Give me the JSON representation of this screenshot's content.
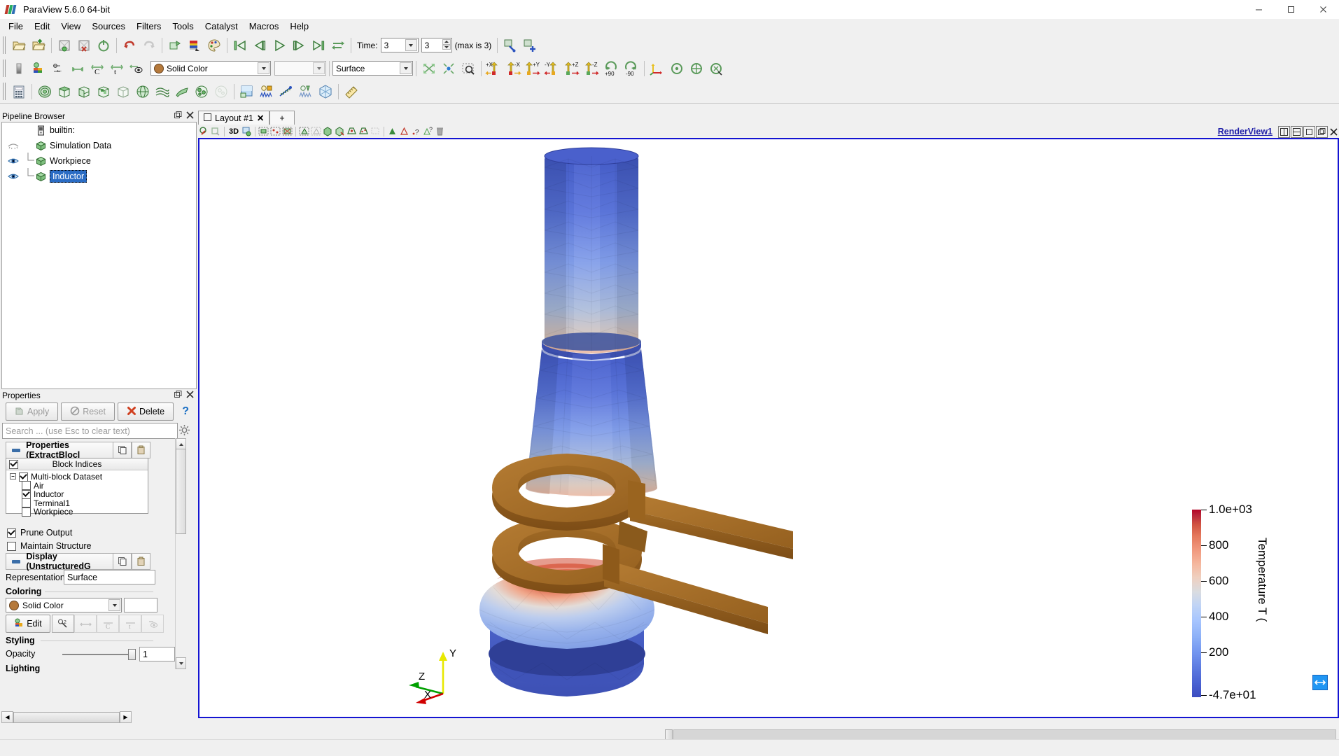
{
  "window": {
    "title": "ParaView 5.6.0 64-bit",
    "minimize": "─",
    "maximize": "☐",
    "close": "✕"
  },
  "menu": [
    "File",
    "Edit",
    "View",
    "Sources",
    "Filters",
    "Tools",
    "Catalyst",
    "Macros",
    "Help"
  ],
  "toolbar": {
    "time_label": "Time:",
    "time_value": "3",
    "time_index": "3",
    "time_max_text": "(max is 3)",
    "coloring_field": "Solid Color",
    "array_component": "",
    "representation": "Surface",
    "rotate_plus_90": "+90",
    "rotate_minus_90": "-90",
    "axis_buttons": [
      "+X",
      "-X",
      "+Y",
      "-Y",
      "+Z",
      "-Z"
    ]
  },
  "pipeline": {
    "panel_title": "Pipeline Browser",
    "items": [
      {
        "label": "builtin:",
        "type": "server",
        "depth": 0,
        "eye": "none",
        "selected": false
      },
      {
        "label": "Simulation Data",
        "type": "source",
        "depth": 0,
        "eye": "off",
        "selected": false
      },
      {
        "label": "Workpiece",
        "type": "source",
        "depth": 1,
        "eye": "on",
        "selected": false
      },
      {
        "label": "Inductor",
        "type": "source",
        "depth": 1,
        "eye": "on",
        "selected": true
      }
    ]
  },
  "properties": {
    "panel_title": "Properties",
    "apply_label": "Apply",
    "reset_label": "Reset",
    "delete_label": "Delete",
    "help_label": "?",
    "search_placeholder": "Search ... (use Esc to clear text)",
    "section_properties": "Properties (ExtractBlocl",
    "block_indices_header": "Block Indices",
    "block_tree": [
      {
        "label": "Multi-block Dataset",
        "checked": true,
        "depth": 0
      },
      {
        "label": "Air",
        "checked": false,
        "depth": 1
      },
      {
        "label": "Inductor",
        "checked": true,
        "depth": 1
      },
      {
        "label": "Terminal1",
        "checked": false,
        "depth": 1
      },
      {
        "label": "Workpiece",
        "checked": false,
        "depth": 1
      }
    ],
    "prune_output": {
      "label": "Prune Output",
      "checked": true
    },
    "maintain_structure": {
      "label": "Maintain Structure",
      "checked": false
    },
    "section_display": "Display (UnstructuredG",
    "representation_label": "Representation",
    "representation_value": "Surface",
    "coloring_label": "Coloring",
    "coloring_value": "Solid Color",
    "edit_label": "Edit",
    "styling_label": "Styling",
    "opacity_label": "Opacity",
    "opacity_value": "1",
    "lighting_label": "Lighting"
  },
  "layout": {
    "tab_label": "Layout #1",
    "tab_close": "✕",
    "new_tab": "+",
    "view_3d_label": "3D"
  },
  "view": {
    "name": "RenderView1",
    "split_horizontal": "◫",
    "split_vertical": "▤",
    "maximize": "□",
    "undock": "❐",
    "close": "✕"
  },
  "legend": {
    "title": "Temperature T (",
    "max_label": "1.0e+03",
    "min_label": "-4.7e+01",
    "ticks": [
      {
        "label": "1.0e+03",
        "value": 1000
      },
      {
        "label": "800",
        "value": 800
      },
      {
        "label": "600",
        "value": 600
      },
      {
        "label": "400",
        "value": 400
      },
      {
        "label": "200",
        "value": 200
      },
      {
        "label": "-4.7e+01",
        "value": -47
      }
    ],
    "range_min": -47,
    "range_max": 1000,
    "colormap": "Cool to Warm"
  },
  "axes": {
    "x": "X",
    "y": "Y",
    "z": "Z"
  },
  "colors": {
    "accent_blue": "#1414d2",
    "selection_blue": "#2a6cc4",
    "copper": "#a8712a",
    "cold_blue": "#3b4cc0",
    "hot_red": "#b40426"
  }
}
